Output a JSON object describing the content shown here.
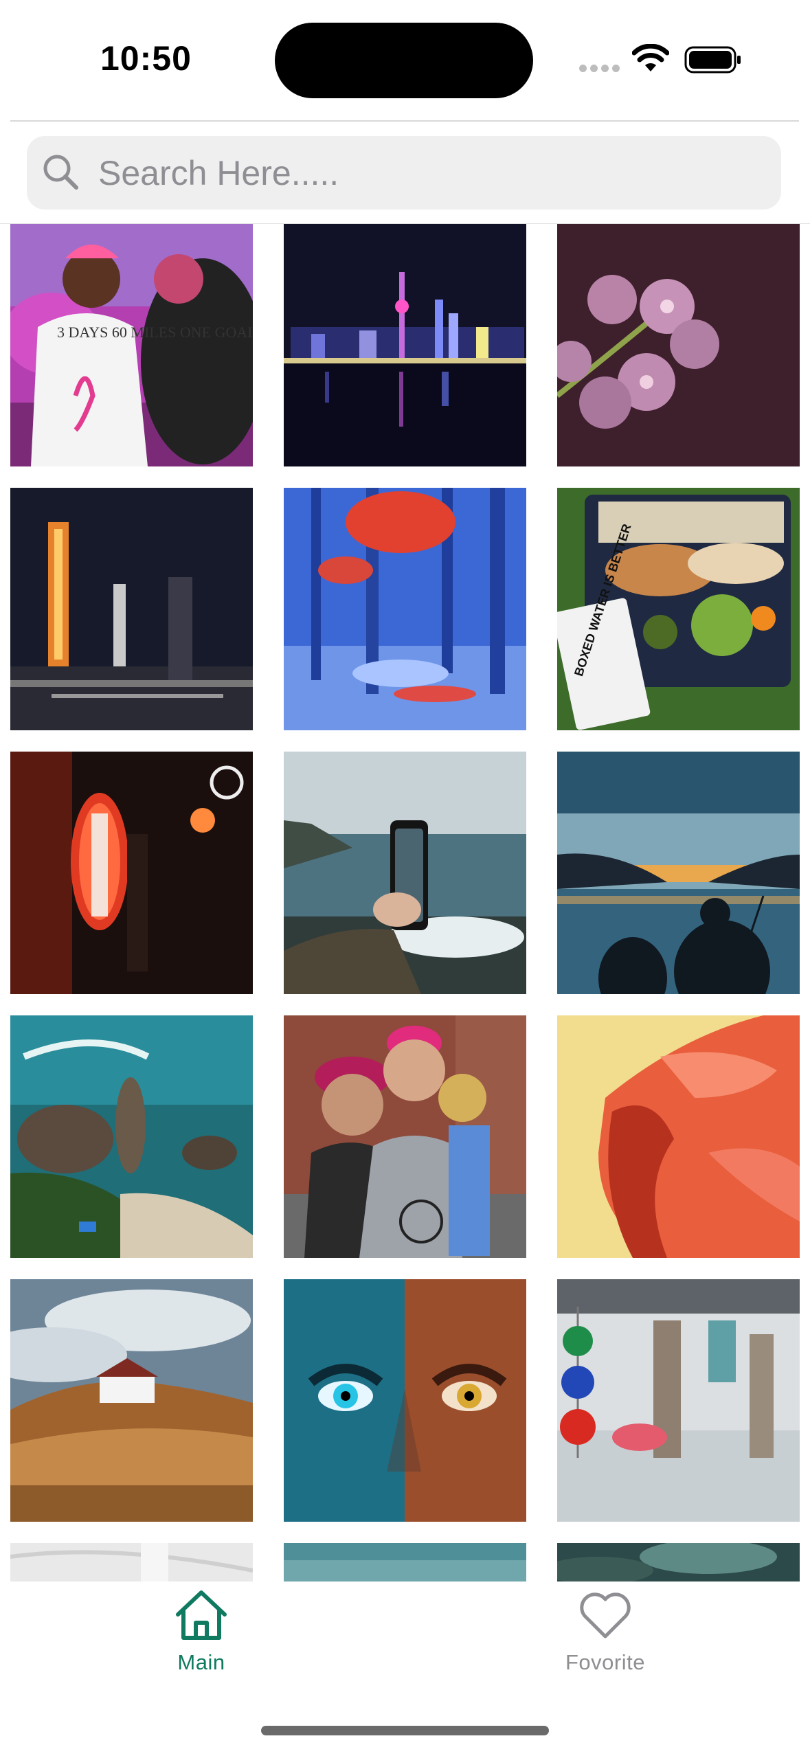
{
  "status_bar": {
    "time": "10:50"
  },
  "search": {
    "placeholder": "Search Here....."
  },
  "grid": {
    "photos": [
      {
        "subject": "pink-ribbon-walk-photo",
        "caption": "3 DAYS 60 MILES ONE GOAL"
      },
      {
        "subject": "night-city-skyline-photo"
      },
      {
        "subject": "orchid-flowers-photo"
      },
      {
        "subject": "night-street-lanterns-photo"
      },
      {
        "subject": "blue-red-forest-photo"
      },
      {
        "subject": "picnic-basket-food-photo",
        "caption": "BOXED WATER IS BETTER"
      },
      {
        "subject": "japanese-lanterns-alley-photo"
      },
      {
        "subject": "hand-holding-phone-sea-photo"
      },
      {
        "subject": "sunset-lake-silhouettes-photo"
      },
      {
        "subject": "aerial-beach-waves-photo"
      },
      {
        "subject": "women-in-pink-caps-photo"
      },
      {
        "subject": "abstract-red-shape-photo"
      },
      {
        "subject": "house-on-hill-photo"
      },
      {
        "subject": "split-color-eyes-photo"
      },
      {
        "subject": "colorful-glass-ornaments-photo"
      },
      {
        "subject": "partial-marble-photo"
      },
      {
        "subject": "partial-teal-sky-photo"
      },
      {
        "subject": "partial-aerial-coast-photo"
      }
    ]
  },
  "tab_bar": {
    "tabs": [
      {
        "label": "Main",
        "icon": "home-icon",
        "active": true
      },
      {
        "label": "Fovorite",
        "icon": "heart-icon",
        "active": false
      }
    ]
  },
  "colors": {
    "accent": "#0f7a60",
    "inactive": "#8e8e93",
    "search_bg": "#efeff0"
  }
}
